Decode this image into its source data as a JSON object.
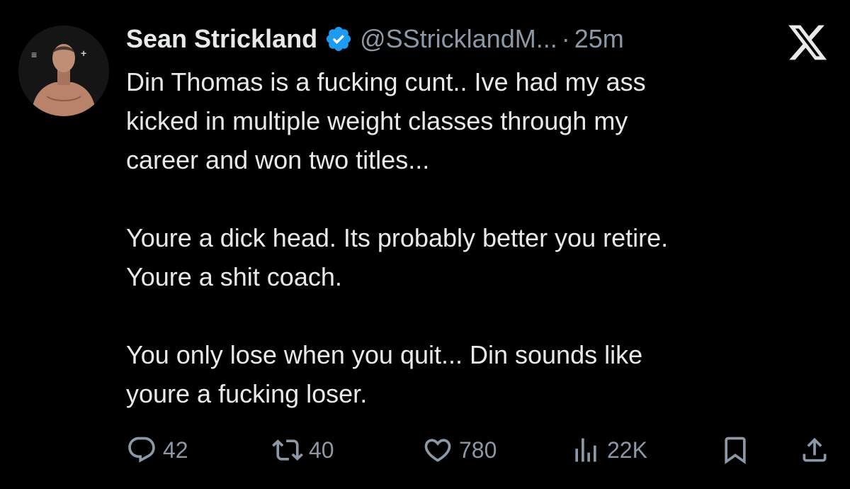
{
  "app": "X",
  "colors": {
    "background": "#000000",
    "text": "#e7e9ea",
    "muted": "#8b98a5",
    "verified": "#1d9bf0"
  },
  "tweet": {
    "author_name": "Sean Strickland",
    "handle": "@SStricklandM...",
    "separator": "·",
    "time": "25m",
    "verified_icon": "verified-badge-icon",
    "paragraphs": [
      "Din Thomas is a fucking cunt.. Ive had my ass\nkicked in multiple weight classes through my\ncareer and won two titles...",
      "Youre a dick head. Its probably better you retire.\nYoure a shit coach.",
      "You only lose when you quit... Din sounds like\nyoure a fucking loser."
    ],
    "actions": {
      "replies": "42",
      "reposts": "40",
      "likes": "780",
      "views": "22K"
    },
    "icons": {
      "reply": "speech-bubble-icon",
      "repost": "repost-arrows-icon",
      "like": "heart-icon",
      "views": "bar-chart-icon",
      "bookmark": "bookmark-icon",
      "share": "share-upload-icon",
      "brand": "x-logo-icon"
    }
  }
}
